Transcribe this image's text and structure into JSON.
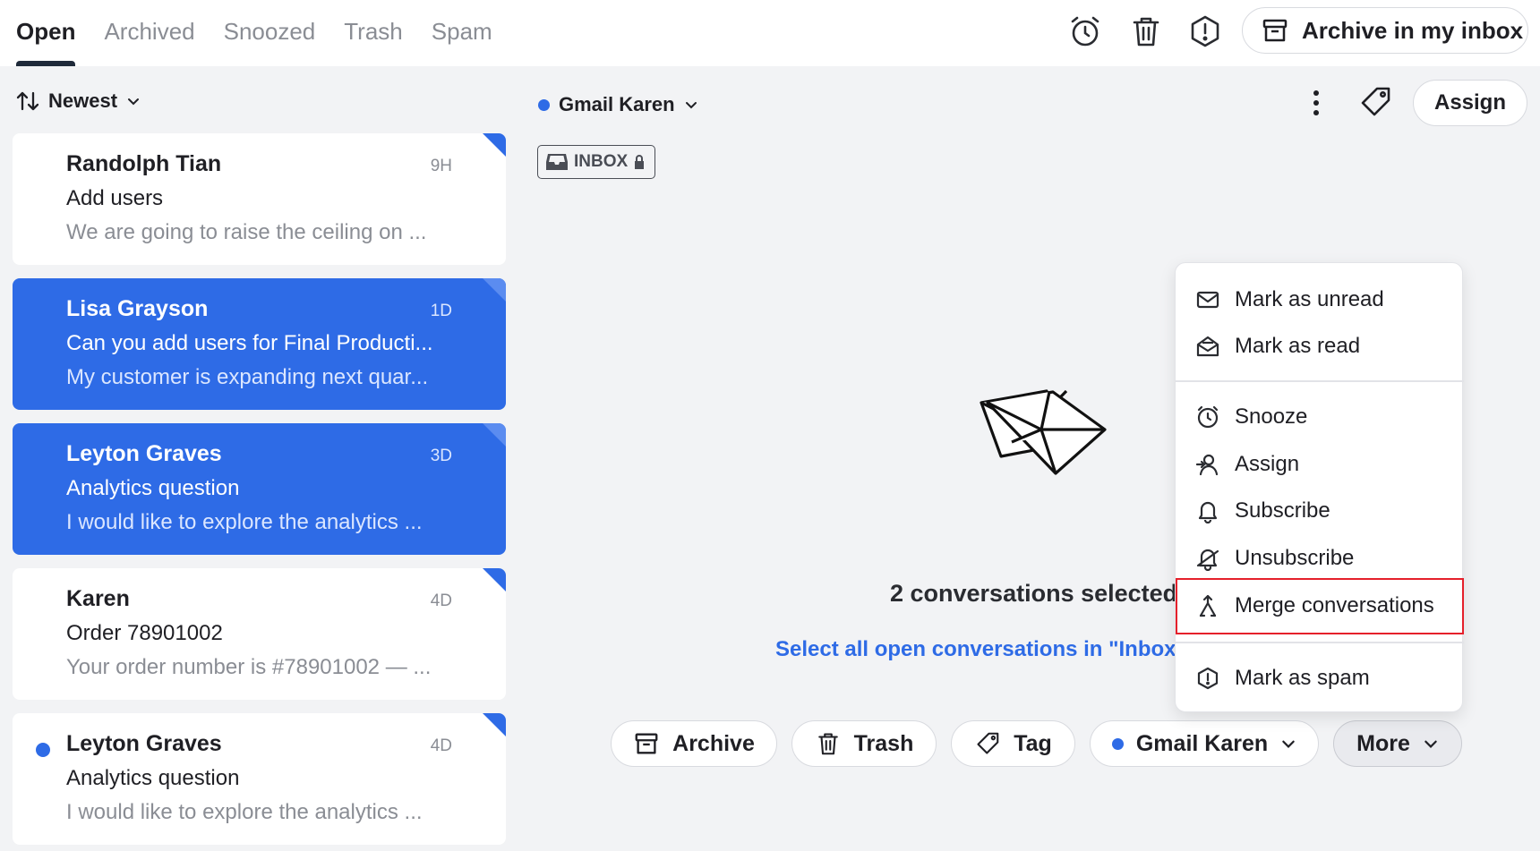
{
  "tabs": [
    {
      "label": "Open",
      "active": true
    },
    {
      "label": "Archived",
      "active": false
    },
    {
      "label": "Snoozed",
      "active": false
    },
    {
      "label": "Trash",
      "active": false
    },
    {
      "label": "Spam",
      "active": false
    }
  ],
  "top_actions": {
    "icons": [
      "alarm-clock-icon",
      "trash-icon",
      "spam-icon"
    ],
    "archive_button": "Archive in my inbox"
  },
  "sort": {
    "label": "Newest"
  },
  "conversations": [
    {
      "name": "Randolph Tian",
      "time": "9H",
      "subject": "Add users",
      "preview": "We are going to raise the ceiling on ...",
      "selected": false,
      "unread": false
    },
    {
      "name": "Lisa Grayson",
      "time": "1D",
      "subject": "Can you add users for Final Producti...",
      "preview": "My customer is expanding next quar...",
      "selected": true,
      "unread": false
    },
    {
      "name": "Leyton Graves",
      "time": "3D",
      "subject": "Analytics question",
      "preview": "I would like to explore the analytics ...",
      "selected": true,
      "unread": false
    },
    {
      "name": "Karen",
      "time": "4D",
      "subject": "Order 78901002",
      "preview": "Your order number is #78901002 — ...",
      "selected": false,
      "unread": false
    },
    {
      "name": "Leyton Graves",
      "time": "4D",
      "subject": "Analytics question",
      "preview": "I would like to explore the analytics ...",
      "selected": false,
      "unread": true
    }
  ],
  "main": {
    "inbox_name": "Gmail Karen",
    "assign_label": "Assign",
    "inbox_chip": "INBOX",
    "selected_count": "2 conversations selected",
    "select_all": "Select all open conversations in \"Inbox\""
  },
  "bulk_actions": {
    "archive": "Archive",
    "trash": "Trash",
    "tag": "Tag",
    "inbox": "Gmail Karen",
    "more": "More"
  },
  "more_menu": {
    "items": [
      {
        "label": "Mark as unread",
        "icon": "envelope-icon"
      },
      {
        "label": "Mark as read",
        "icon": "envelope-open-icon"
      },
      {
        "label": "Snooze",
        "icon": "alarm-clock-icon"
      },
      {
        "label": "Assign",
        "icon": "assign-icon"
      },
      {
        "label": "Subscribe",
        "icon": "bell-icon"
      },
      {
        "label": "Unsubscribe",
        "icon": "bell-off-icon"
      },
      {
        "label": "Merge conversations",
        "icon": "merge-icon",
        "highlighted": true
      },
      {
        "label": "Mark as spam",
        "icon": "spam-icon"
      }
    ]
  },
  "colors": {
    "accent": "#2e6be6",
    "highlight": "#e5202b"
  }
}
